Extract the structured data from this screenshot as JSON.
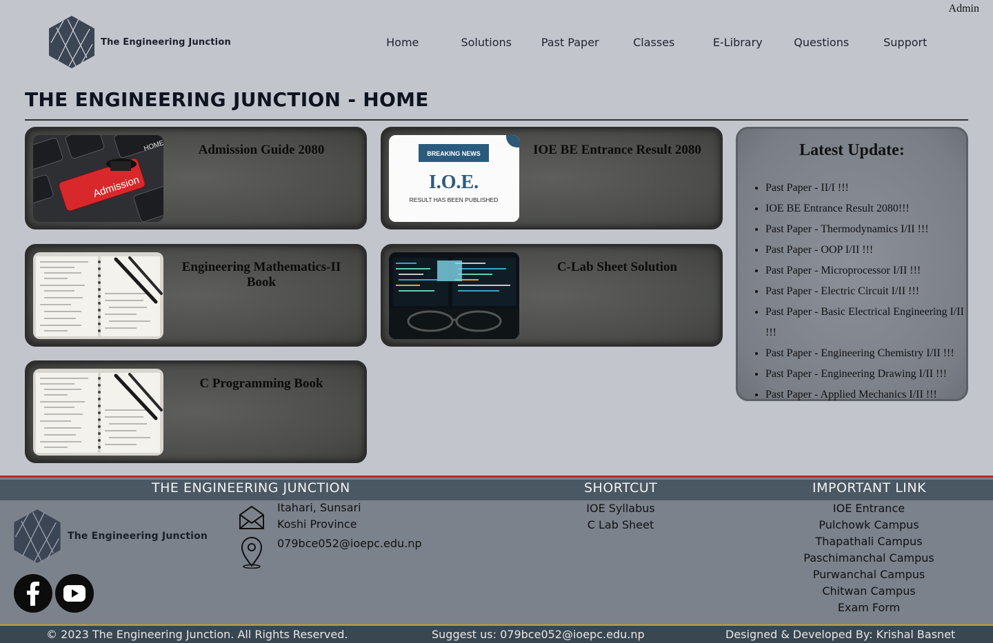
{
  "header": {
    "admin_label": "Admin",
    "logo_text": "The Engineering Junction",
    "nav": [
      "Home",
      "Solutions",
      "Past Paper",
      "Classes",
      "E-Library",
      "Questions",
      "Support"
    ]
  },
  "page_title": "THE ENGINEERING JUNCTION - HOME",
  "cards": [
    {
      "title": "Admission Guide 2080",
      "thumb_word": "Admission",
      "thumb_key": "HOME"
    },
    {
      "title": "IOE BE Entrance Result 2080",
      "thumb_badge": "BREAKING NEWS",
      "thumb_big": "I.O.E.",
      "thumb_sub": "RESULT HAS BEEN PUBLISHED"
    },
    {
      "title": "Engineering Mathematics-II Book"
    },
    {
      "title": "C-Lab Sheet Solution"
    },
    {
      "title": "C Programming Book"
    }
  ],
  "latest": {
    "heading": "Latest Update:",
    "items": [
      "Past Paper - II/I !!!",
      "IOE BE Entrance Result 2080!!!",
      "Past Paper - Thermodynamics I/II !!!",
      "Past Paper - OOP I/II !!!",
      "Past Paper - Microprocessor I/II !!!",
      "Past Paper - Electric Circuit I/II !!!",
      "Past Paper - Basic Electrical Engineering I/II !!!",
      "Past Paper - Engineering Chemistry I/II !!!",
      "Past Paper - Engineering Drawing I/II !!!",
      "Past Paper - Applied Mechanics I/II !!!"
    ]
  },
  "footer": {
    "col1_heading": "THE ENGINEERING JUNCTION",
    "col2_heading": "SHORTCUT",
    "col3_heading": "IMPORTANT LINK",
    "logo_text": "The Engineering Junction",
    "address_line1": "Itahari, Sunsari",
    "address_line2": "Koshi Province",
    "email": "079bce052@ioepc.edu.np",
    "shortcuts": [
      "IOE Syllabus",
      "C Lab Sheet"
    ],
    "links": [
      "IOE Entrance",
      "Pulchowk Campus",
      "Thapathali Campus",
      "Paschimanchal Campus",
      "Purwanchal Campus",
      "Chitwan Campus",
      "Exam Form"
    ],
    "social": [
      "facebook-icon",
      "youtube-icon"
    ]
  },
  "bottom_bar": {
    "copyright": "© 2023 The Engineering Junction. All Rights Reserved.",
    "suggest": "Suggest us: 079bce052@ioepc.edu.np",
    "designer": "Designed & Developed By: Krishal Basnet"
  }
}
